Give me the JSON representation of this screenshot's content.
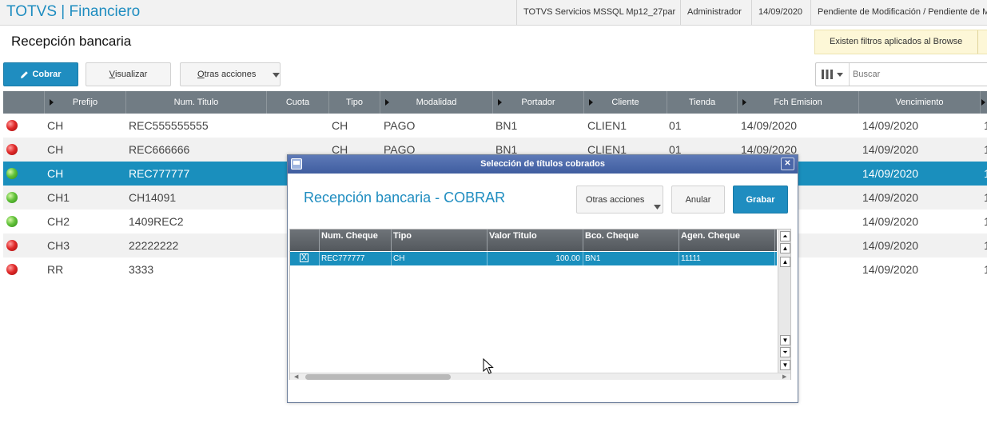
{
  "app": {
    "title": "TOTVS | Financiero",
    "info": [
      "TOTVS Servicios MSSQL Mp12_27par",
      "Administrador",
      "14/09/2020",
      "Pendiente de Modificación / Pendiente de Mo"
    ]
  },
  "page": {
    "title": "Recepción bancaria",
    "filter_notice": "Existen filtros aplicados al Browse"
  },
  "toolbar": {
    "cobrar": "Cobrar",
    "visualizar_first": "V",
    "visualizar_rest": "isualizar",
    "otras_first": "O",
    "otras_rest": "tras acciones",
    "search_placeholder": "Buscar"
  },
  "grid": {
    "columns": [
      "Prefijo",
      "Num. Titulo",
      "Cuota",
      "Tipo",
      "Modalidad",
      "Portador",
      "Cliente",
      "Tienda",
      "Fch Emision",
      "Vencimiento"
    ],
    "rows": [
      {
        "status": "red",
        "prefijo": "CH",
        "num": "REC555555555",
        "tipo": "CH",
        "modalidad": "PAGO",
        "portador": "BN1",
        "cliente": "CLIEN1",
        "tienda": "01",
        "emision": "14/09/2020",
        "venc": "14/09/2020",
        "extra": "1"
      },
      {
        "status": "red",
        "prefijo": "CH",
        "num": "REC666666",
        "tipo": "CH",
        "modalidad": "PAGO",
        "portador": "BN1",
        "cliente": "CLIEN1",
        "tienda": "01",
        "emision": "14/09/2020",
        "venc": "14/09/2020",
        "extra": "1"
      },
      {
        "status": "green",
        "prefijo": "CH",
        "num": "REC777777",
        "venc": "14/09/2020",
        "extra": "1"
      },
      {
        "status": "green",
        "prefijo": "CH1",
        "num": "CH14091",
        "venc": "14/09/2020",
        "extra": "1"
      },
      {
        "status": "green",
        "prefijo": "CH2",
        "num": "1409REC2",
        "venc": "14/09/2020",
        "extra": "1"
      },
      {
        "status": "red",
        "prefijo": "CH3",
        "num": "22222222",
        "venc": "14/09/2020",
        "extra": "1"
      },
      {
        "status": "red",
        "prefijo": "RR",
        "num": "3333",
        "venc": "14/09/2020",
        "extra": "1"
      }
    ]
  },
  "modal": {
    "title": "Selección de títulos cobrados",
    "heading": "Recepción bancaria - COBRAR",
    "otras_acciones": "Otras acciones",
    "anular": "Anular",
    "grabar": "Grabar",
    "columns": [
      "Num. Cheque",
      "Tipo",
      "Valor Titulo",
      "Bco. Cheque",
      "Agen. Cheque"
    ],
    "rows": [
      {
        "checked": "X",
        "num_cheque": "REC777777",
        "tipo": "CH",
        "valor": "100.00",
        "banco": "BN1",
        "agencia": "11111"
      }
    ]
  },
  "colors": {
    "accent": "#1f8dc0",
    "grid_header": "#717c84",
    "selected_row": "#1a8fbd",
    "modal_titlebar": "#3f5d9f",
    "status_red": "#e02a2a",
    "status_green": "#62c23a"
  },
  "icons": {
    "cobrar": "pencil-icon",
    "search_columns": "column-bars-icon",
    "close": "close-icon"
  }
}
